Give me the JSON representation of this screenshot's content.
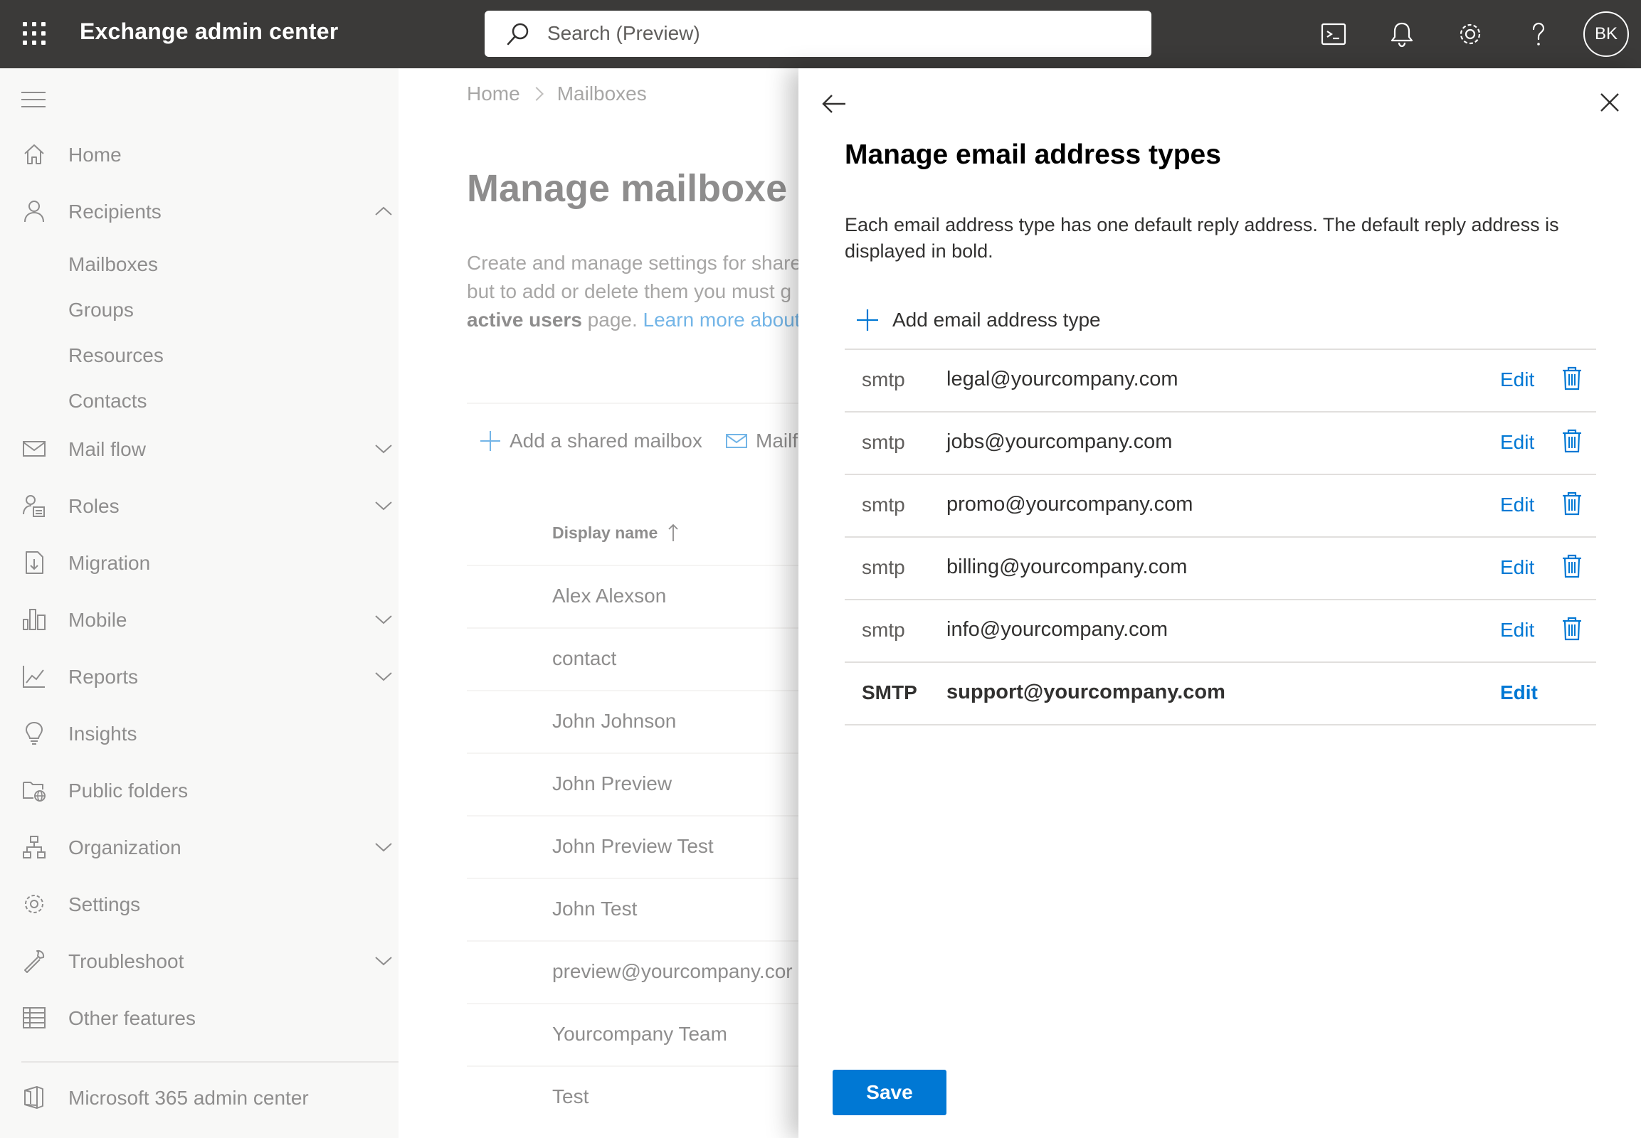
{
  "header": {
    "app_title": "Exchange admin center",
    "search_placeholder": "Search (Preview)",
    "avatar_initials": "BK",
    "icons": [
      "app-launcher-icon",
      "terminal-icon",
      "bell-icon",
      "gear-icon",
      "help-icon"
    ]
  },
  "nav": {
    "items": [
      {
        "label": "Home",
        "icon": "home-icon"
      },
      {
        "label": "Recipients",
        "icon": "person-icon",
        "expanded": true
      },
      {
        "label": "Mail flow",
        "icon": "mail-icon"
      },
      {
        "label": "Roles",
        "icon": "roles-icon"
      },
      {
        "label": "Migration",
        "icon": "migration-icon"
      },
      {
        "label": "Mobile",
        "icon": "mobile-icon"
      },
      {
        "label": "Reports",
        "icon": "reports-icon"
      },
      {
        "label": "Insights",
        "icon": "lightbulb-icon"
      },
      {
        "label": "Public folders",
        "icon": "public-folder-icon"
      },
      {
        "label": "Organization",
        "icon": "organization-icon"
      },
      {
        "label": "Settings",
        "icon": "gear-icon"
      },
      {
        "label": "Troubleshoot",
        "icon": "wrench-icon"
      },
      {
        "label": "Other features",
        "icon": "grid-icon"
      }
    ],
    "recipients_sub": [
      "Mailboxes",
      "Groups",
      "Resources",
      "Contacts"
    ],
    "footer_link": "Microsoft 365 admin center"
  },
  "main": {
    "breadcrumb": [
      "Home",
      "Mailboxes"
    ],
    "title": "Manage mailboxe",
    "desc_line1": "Create and manage settings for shared",
    "desc_line2": "but to add or delete them you must g",
    "desc_bold": "active users",
    "desc_mid": " page. ",
    "desc_link": "Learn more about",
    "cmd_add": "Add a shared mailbox",
    "cmd_mail": "Mailf",
    "col_display_name": "Display name",
    "rows": [
      "Alex Alexson",
      "contact",
      "John Johnson",
      "John Preview",
      "John Preview Test",
      "John Test",
      "preview@yourcompany.cor",
      "Yourcompany Team",
      "Test"
    ]
  },
  "panel": {
    "title": "Manage email address types",
    "description": "Each email address type has one default reply address. The default reply address is displayed in bold.",
    "add_label": "Add email address type",
    "addresses": [
      {
        "type": "smtp",
        "email": "legal@yourcompany.com",
        "edit": "Edit"
      },
      {
        "type": "smtp",
        "email": "jobs@yourcompany.com",
        "edit": "Edit"
      },
      {
        "type": "smtp",
        "email": "promo@yourcompany.com",
        "edit": "Edit"
      },
      {
        "type": "smtp",
        "email": "billing@yourcompany.com",
        "edit": "Edit"
      },
      {
        "type": "smtp",
        "email": "info@yourcompany.com",
        "edit": "Edit"
      },
      {
        "type": "SMTP",
        "email": "support@yourcompany.com",
        "edit": "Edit",
        "primary": true
      }
    ],
    "save_label": "Save"
  },
  "colors": {
    "topbar": "#3b3a39",
    "nav_bg": "#f3f2f1",
    "accent": "#0078d4",
    "text": "#323130"
  }
}
